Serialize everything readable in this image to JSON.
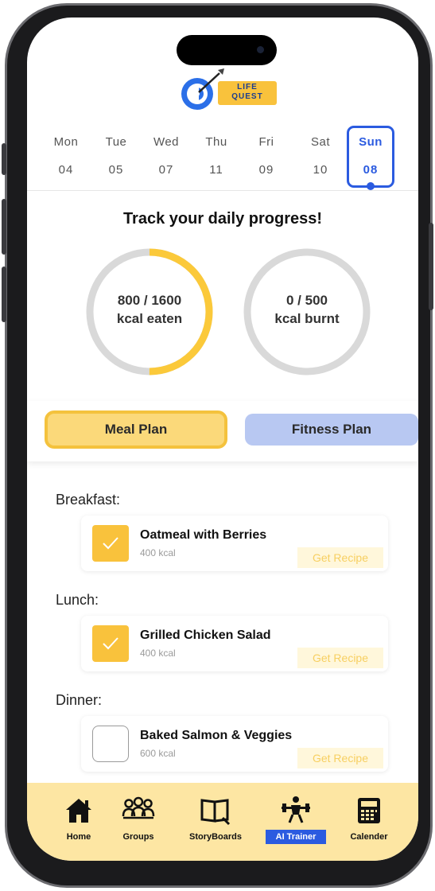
{
  "app": {
    "logo_text": "LIFE QUEST"
  },
  "week": {
    "days": [
      {
        "name": "Mon",
        "num": "04"
      },
      {
        "name": "Tue",
        "num": "05"
      },
      {
        "name": "Wed",
        "num": "07"
      },
      {
        "name": "Thu",
        "num": "11"
      },
      {
        "name": "Fri",
        "num": "09"
      },
      {
        "name": "Sat",
        "num": "10"
      },
      {
        "name": "Sun",
        "num": "08"
      }
    ],
    "selected": "Sun"
  },
  "progress": {
    "title": "Track your daily progress!",
    "eaten": {
      "value": "800 / 1600",
      "label": "kcal eaten",
      "fraction": 0.5
    },
    "burnt": {
      "value": "0 / 500",
      "label": "kcal burnt",
      "fraction": 0
    }
  },
  "tabs": {
    "meal": "Meal Plan",
    "fitness": "Fitness Plan",
    "active": "meal"
  },
  "meals": [
    {
      "section": "Breakfast:",
      "name": "Oatmeal with Berries",
      "kcal": "400 kcal",
      "checked": true,
      "recipe": "Get Recipe"
    },
    {
      "section": "Lunch:",
      "name": "Grilled Chicken Salad",
      "kcal": "400 kcal",
      "checked": true,
      "recipe": "Get Recipe"
    },
    {
      "section": "Dinner:",
      "name": "Baked Salmon & Veggies",
      "kcal": "600 kcal",
      "checked": false,
      "recipe": "Get Recipe"
    }
  ],
  "nav": [
    {
      "label": "Home",
      "icon": "home-icon"
    },
    {
      "label": "Groups",
      "icon": "groups-icon"
    },
    {
      "label": "StoryBoards",
      "icon": "book-icon"
    },
    {
      "label": "AI Trainer",
      "icon": "dumbbell-icon",
      "active": true
    },
    {
      "label": "Calender",
      "icon": "calculator-icon"
    }
  ],
  "colors": {
    "accent_blue": "#2b5be0",
    "accent_yellow": "#f9c23c",
    "nav_bg": "#fde6a3"
  }
}
